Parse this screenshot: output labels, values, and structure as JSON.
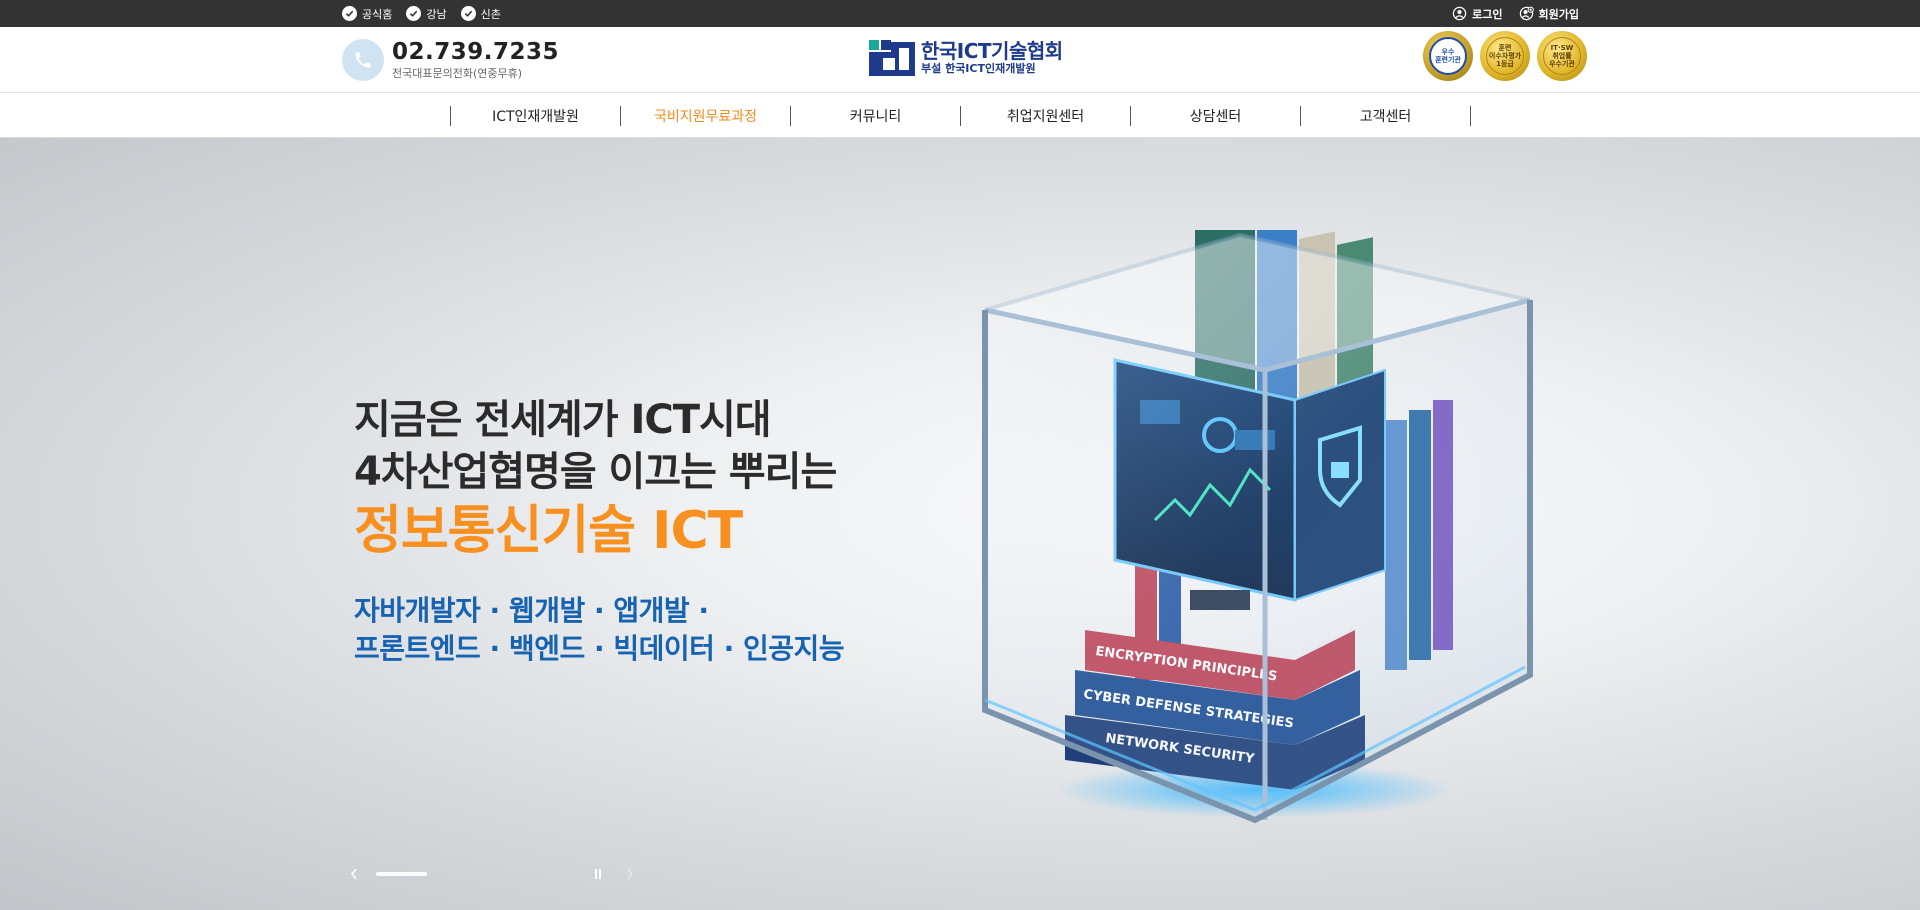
{
  "topbar": {
    "branches": [
      {
        "label": "공식홈",
        "icon": "check-circle-icon"
      },
      {
        "label": "강남",
        "icon": "check-circle-icon"
      },
      {
        "label": "신촌",
        "icon": "check-circle-icon"
      }
    ],
    "login_label": "로그인",
    "signup_label": "회원가입"
  },
  "header": {
    "phone_number": "02.739.7235",
    "phone_caption": "전국대표문의전화(연중무휴)",
    "logo_title": "한국ICT기술협회",
    "logo_subtitle": "부설 한국ICT인재개발원",
    "badges": [
      {
        "text": "우수\n훈련기관",
        "style": "blue"
      },
      {
        "text": "훈련\n이수자평가\n1등급",
        "style": "gold"
      },
      {
        "text": "IT·SW\n취업률\n우수기관",
        "style": "gold"
      }
    ]
  },
  "nav": {
    "items": [
      {
        "label": "ICT인재개발원",
        "active": false
      },
      {
        "label": "국비지원무료과정",
        "active": true
      },
      {
        "label": "커뮤니티",
        "active": false
      },
      {
        "label": "취업지원센터",
        "active": false
      },
      {
        "label": "상담센터",
        "active": false
      },
      {
        "label": "고객센터",
        "active": false
      }
    ],
    "accent_color": "#f28a1c"
  },
  "hero": {
    "line1": "지금은 전세계가 ICT시대",
    "line2": "4차산업협명을 이끄는 뿌리는",
    "accent": "정보통신기술 ICT",
    "sub1": "자바개발자 · 웹개발 · 앱개발 ·",
    "sub2": "프론트엔드 · 백엔드 · 빅데이터 · 인공지능",
    "accent_color": "#f7901e",
    "sub_color": "#1763b2",
    "slider_progress": 0.26,
    "slide_books": [
      "ENCRYPTION PRINCIPLES",
      "CYBER DEFENSE STRATEGIES",
      "NETWORK SECURITY"
    ]
  }
}
